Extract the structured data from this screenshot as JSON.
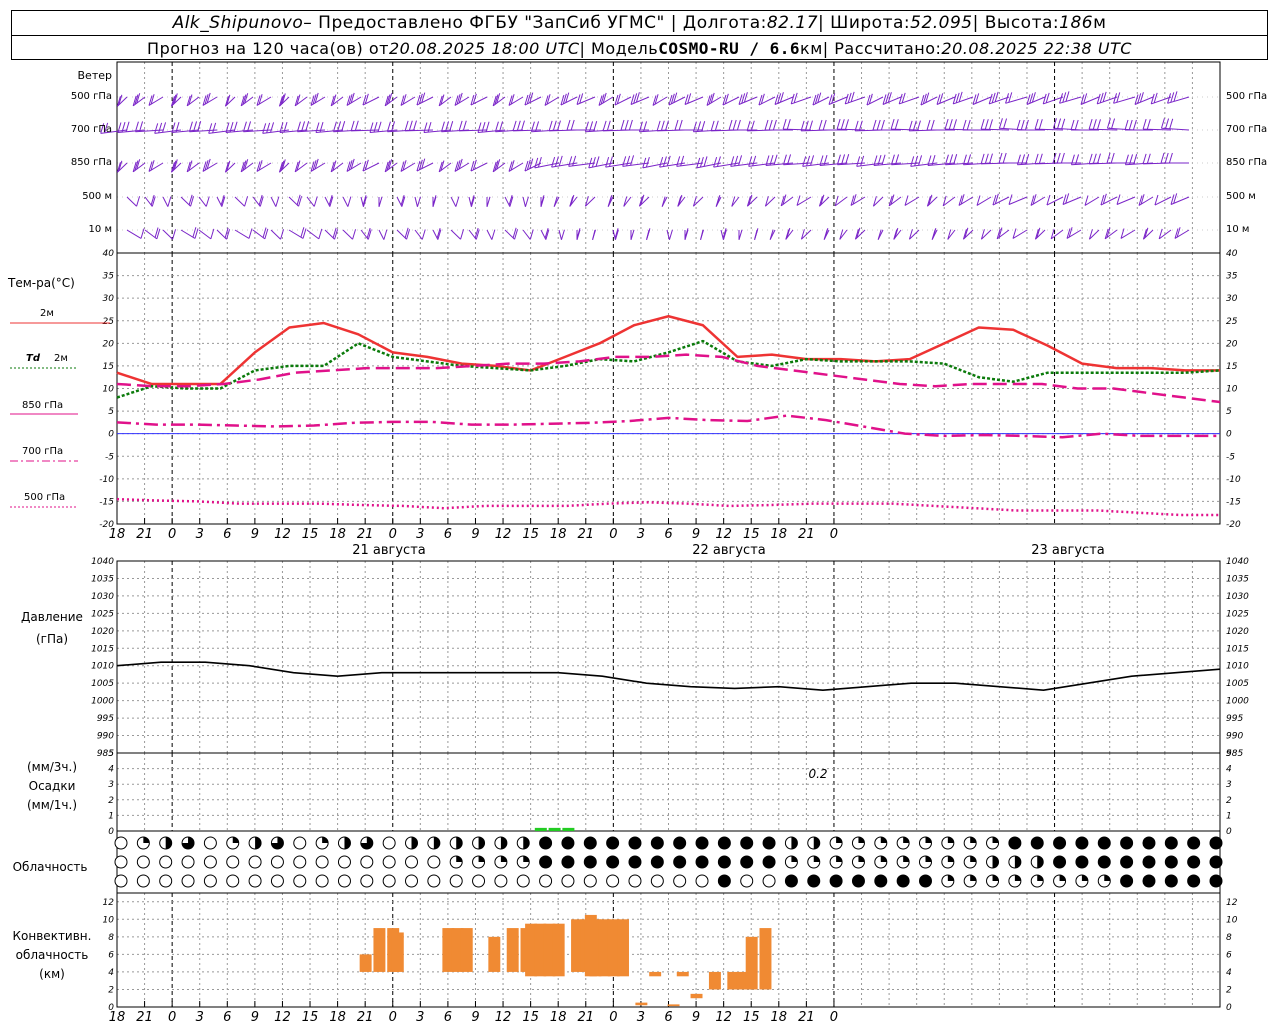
{
  "header": {
    "line1": {
      "station": "Alk_Shipunovo",
      "provider": " – Предоставлено ФГБУ \"ЗапСиб УГМС\" | Долгота: ",
      "lon": "82.17",
      "lat_label": " | Широта: ",
      "lat": "52.095",
      "alt_label": " | Высота: ",
      "alt": "186",
      "alt_unit": "м"
    },
    "line2": {
      "forecast_label": "Прогноз на 120 часа(ов) от ",
      "run_time": "20.08.2025 18:00 UTC",
      "model_label": "  | Модель ",
      "model": "COSMO-RU / 6.6",
      "model_unit": "км",
      "computed_label": " | Рассчитано: ",
      "computed_time": "20.08.2025 22:38 UTC"
    }
  },
  "labels": {
    "wind": "Ветер",
    "wind_levels": [
      "500 гПа",
      "700 гПа",
      "850 гПа",
      "500 м",
      "10 м"
    ],
    "temp": "Тем-ра(°С)",
    "series_2m": "2м",
    "series_td": "Td",
    "series_td_2": "2м",
    "series_850": "850 гПа",
    "series_700": "700 гПа",
    "series_500": "500 гПа",
    "pressure_1": "Давление",
    "pressure_2": "(гПа)",
    "precip_1": "(мм/3ч.)",
    "precip_2": "Осадки",
    "precip_3": "(мм/1ч.)",
    "precip_value": "0.2",
    "cloud": "Облачность",
    "conv_1": "Конвективн.",
    "conv_2": "облачность",
    "conv_3": "(км)"
  },
  "time_axis": {
    "ticks": [
      "18",
      "21",
      "0",
      "3",
      "6",
      "9",
      "12",
      "15",
      "18",
      "21",
      "0",
      "3",
      "6",
      "9",
      "12",
      "15",
      "18",
      "21",
      "0",
      "3",
      "6",
      "9",
      "12",
      "15",
      "18",
      "21",
      "0"
    ],
    "days": [
      "21 августа",
      "22 августа",
      "23 августа"
    ]
  },
  "colors": {
    "t2m": "#ee3333",
    "td": "#0a7a0a",
    "t850": "#e0118a",
    "t700": "#e0118a",
    "t500": "#e0118a",
    "wind": "#7a24c8",
    "pressure": "#000000",
    "precip": "#22cc22",
    "conv": "#f08a33",
    "zero_line": "#3333ff"
  },
  "chart_data": [
    {
      "type": "line",
      "name": "temperature",
      "x_hours": [
        0,
        3,
        6,
        9,
        12,
        15,
        18,
        21,
        24,
        27,
        30,
        33,
        36,
        39,
        42,
        45,
        48,
        51,
        54,
        57,
        60,
        63,
        66,
        69,
        72,
        75,
        78,
        81,
        84,
        87,
        90,
        93,
        96,
        99,
        102,
        105,
        108,
        111,
        114,
        117,
        120
      ],
      "ylim": [
        -20,
        40
      ],
      "yticks": [
        -20,
        -15,
        -10,
        -5,
        0,
        5,
        10,
        15,
        20,
        25,
        30,
        35,
        40
      ],
      "series": [
        {
          "name": "2м",
          "values": [
            13.5,
            11,
            11,
            11,
            18,
            23.5,
            24.5,
            22,
            18,
            17,
            15.5,
            15,
            14,
            17,
            20,
            24,
            26,
            24,
            17,
            17.5,
            16.5,
            16.5,
            16,
            16.5,
            20,
            23.5,
            23,
            19.5,
            15.5,
            14.5,
            14.5,
            14,
            14
          ]
        },
        {
          "name": "Td 2м",
          "values": [
            8,
            10.5,
            10,
            10,
            14,
            15,
            15,
            20,
            17,
            16,
            15,
            14.5,
            14,
            15,
            16.5,
            16,
            18,
            20.5,
            16,
            15,
            16.5,
            16,
            16,
            16,
            15.5,
            12.5,
            11.5,
            13.5,
            13.5,
            13.5,
            13.5,
            13.5,
            14
          ]
        },
        {
          "name": "850 гПа",
          "values": [
            11,
            10.5,
            10.5,
            11,
            12,
            13.5,
            14,
            14.5,
            14.5,
            14.5,
            15,
            15.5,
            15.5,
            16,
            17,
            17,
            17.5,
            17,
            15,
            14,
            13,
            12,
            11,
            10.5,
            11,
            11,
            11,
            10,
            10,
            9,
            8,
            7
          ]
        },
        {
          "name": "700 гПа",
          "values": [
            2.5,
            2,
            2,
            1.8,
            1.6,
            1.8,
            2.4,
            2.6,
            2.6,
            2,
            2,
            2.2,
            2.4,
            2.8,
            3.5,
            3,
            2.8,
            4,
            3,
            1.5,
            0,
            -0.5,
            -0.3,
            -0.5,
            -0.8,
            0,
            -0.5,
            -0.5,
            -0.5
          ]
        },
        {
          "name": "500 гПа",
          "values": [
            -14.5,
            -14.8,
            -15,
            -15.5,
            -15.5,
            -15.5,
            -15.8,
            -16,
            -16.5,
            -16,
            -16,
            -16,
            -15.5,
            -15.2,
            -15.5,
            -16,
            -15.8,
            -15.5,
            -15.5,
            -15.5,
            -16,
            -16.5,
            -17,
            -17,
            -17,
            -17.5,
            -18,
            -18
          ]
        }
      ]
    },
    {
      "type": "line",
      "name": "pressure",
      "ylim": [
        985,
        1040
      ],
      "yticks": [
        985,
        990,
        995,
        1000,
        1005,
        1010,
        1015,
        1020,
        1025,
        1030,
        1035,
        1040
      ],
      "series": [
        {
          "name": "Давление",
          "values": [
            1010,
            1011,
            1011,
            1010,
            1008,
            1007,
            1008,
            1008,
            1008,
            1008,
            1008,
            1007,
            1005,
            1004,
            1003.5,
            1004,
            1003,
            1004,
            1005,
            1005,
            1004,
            1003,
            1005,
            1007,
            1008,
            1009
          ]
        }
      ]
    },
    {
      "type": "bar",
      "name": "precipitation",
      "ylim": [
        0,
        5
      ],
      "annotations": [
        "0.2"
      ],
      "series": [
        {
          "name": "Осадки",
          "x_hours": [
            46,
            47.5,
            49
          ],
          "values": [
            0.2,
            0.2,
            0.2
          ]
        }
      ]
    },
    {
      "type": "bar",
      "name": "convective_cloud",
      "ylim": [
        0,
        13
      ],
      "yticks": [
        0,
        2,
        4,
        6,
        8,
        10,
        12
      ],
      "series": [
        {
          "name": "Конвективн. облачность",
          "bars": [
            [
              27,
              4,
              6
            ],
            [
              28.5,
              4,
              9
            ],
            [
              30,
              4,
              9
            ],
            [
              30.5,
              4,
              8.5
            ],
            [
              36,
              4,
              9
            ],
            [
              37,
              4,
              9
            ],
            [
              38,
              4,
              9
            ],
            [
              41,
              4,
              8
            ],
            [
              43,
              4,
              9
            ],
            [
              44.5,
              4,
              9
            ],
            [
              45,
              3.5,
              9.5
            ],
            [
              46,
              3.5,
              9.5
            ],
            [
              47,
              3.5,
              9.5
            ],
            [
              48,
              3.5,
              9.5
            ],
            [
              50,
              4,
              10
            ],
            [
              51,
              4,
              10
            ],
            [
              51.5,
              3.5,
              10.5
            ],
            [
              52,
              3.5,
              10
            ],
            [
              53,
              3.5,
              10
            ],
            [
              54,
              3.5,
              10
            ],
            [
              55,
              3.5,
              10
            ],
            [
              57,
              0.2,
              0.5
            ],
            [
              58.5,
              3.5,
              4
            ],
            [
              60.5,
              0.1,
              0.3
            ],
            [
              61.5,
              3.5,
              4
            ],
            [
              63,
              1,
              1.5
            ],
            [
              65,
              2,
              4
            ],
            [
              67,
              2,
              4
            ],
            [
              68,
              2,
              4
            ],
            [
              69,
              2,
              8
            ],
            [
              70.5,
              2,
              9
            ]
          ]
        }
      ]
    },
    {
      "type": "table",
      "name": "cloud_cover_symbols",
      "levels": 3,
      "count": 50
    }
  ]
}
